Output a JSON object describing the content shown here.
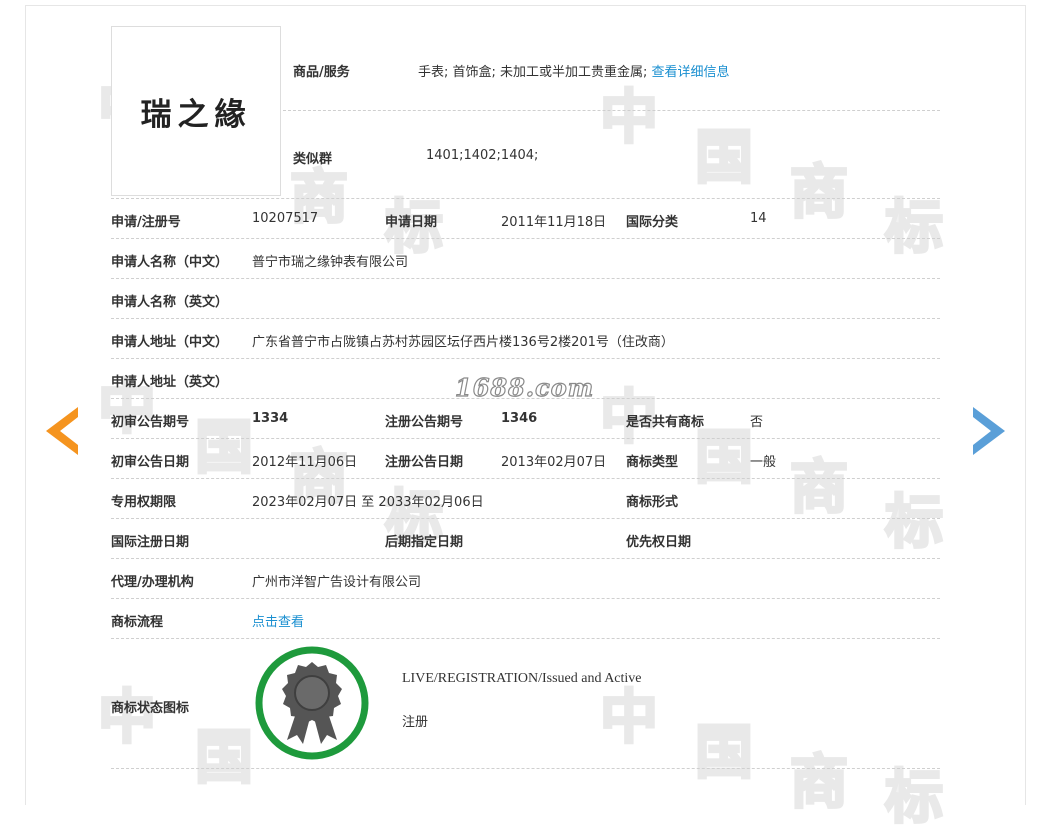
{
  "logo": {
    "text": "瑞之緣"
  },
  "goods_services": {
    "label": "商品/服务",
    "value": "手表; 首饰盒; 未加工或半加工贵重金属;",
    "detail_link": "查看详细信息"
  },
  "similar_group": {
    "label": "类似群",
    "value": "1401;1402;1404;"
  },
  "application": {
    "reg_no_label": "申请/注册号",
    "reg_no": "10207517",
    "date_label": "申请日期",
    "date": "2011年11月18日",
    "intl_class_label": "国际分类",
    "intl_class": "14"
  },
  "applicant": {
    "name_cn_label": "申请人名称（中文）",
    "name_cn": "普宁市瑞之缘钟表有限公司",
    "name_en_label": "申请人名称（英文）",
    "name_en": "",
    "addr_cn_label": "申请人地址（中文）",
    "addr_cn": "广东省普宁市占陇镇占苏村苏园区坛仔西片楼136号2楼201号（住改商）",
    "addr_en_label": "申请人地址（英文）",
    "addr_en": ""
  },
  "watermark_text": "1688.com",
  "publication": {
    "prelim_no_label": "初审公告期号",
    "prelim_no": "1334",
    "reg_pub_no_label": "注册公告期号",
    "reg_pub_no": "1346",
    "shared_label": "是否共有商标",
    "shared": "否",
    "prelim_date_label": "初审公告日期",
    "prelim_date": "2012年11月06日",
    "reg_pub_date_label": "注册公告日期",
    "reg_pub_date": "2013年02月07日",
    "tm_type_label": "商标类型",
    "tm_type": "一般",
    "exclusive_label": "专用权期限",
    "exclusive": "2023年02月07日 至 2033年02月06日",
    "tm_form_label": "商标形式",
    "tm_form": "",
    "intl_reg_date_label": "国际注册日期",
    "intl_reg_date": "",
    "later_date_label": "后期指定日期",
    "later_date": "",
    "priority_date_label": "优先权日期",
    "priority_date": ""
  },
  "agent": {
    "label": "代理/办理机构",
    "value": "广州市洋智广告设计有限公司"
  },
  "process": {
    "label": "商标流程",
    "link": "点击查看"
  },
  "status": {
    "label": "商标状态图标",
    "en": "LIVE/REGISTRATION/Issued and Active",
    "cn": "注册"
  },
  "background_watermark": [
    "中",
    "国",
    "商",
    "标"
  ],
  "colors": {
    "link": "#1a8fd0",
    "arrow_left": "#f5941f",
    "arrow_right": "#5a9fd8",
    "badge_ring": "#1e9a3c",
    "badge_seal": "#555555"
  }
}
